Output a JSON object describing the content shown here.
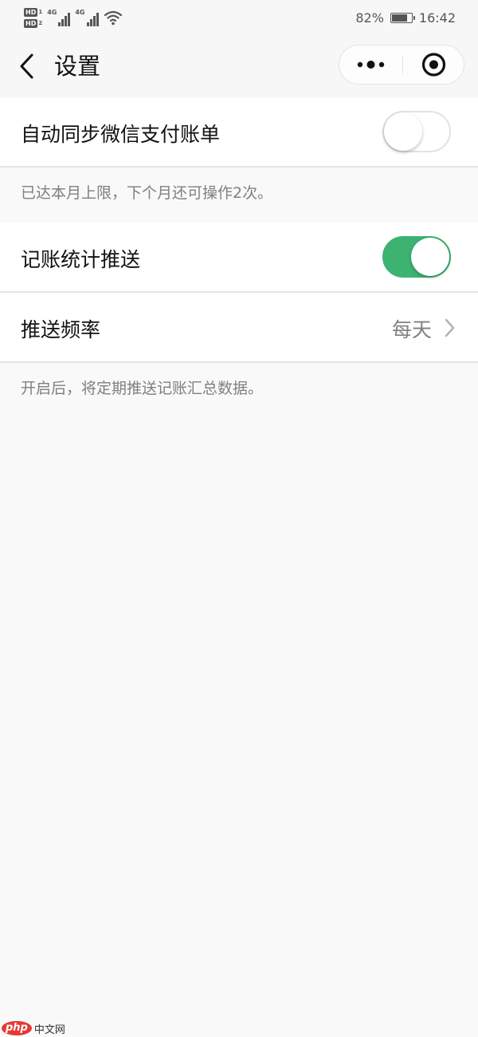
{
  "status_bar": {
    "hd1_label": "HD",
    "hd1_sub": "1",
    "hd2_label": "HD",
    "hd2_sub": "2",
    "network1": "4G",
    "network2": "4G",
    "battery_percent": "82%",
    "battery_level": 0.82,
    "time": "16:42"
  },
  "nav": {
    "title": "设置",
    "icons": {
      "back": "chevron-left-icon",
      "more": "more-dots-icon",
      "close": "target-icon"
    }
  },
  "settings": {
    "sync_bill": {
      "label": "自动同步微信支付账单",
      "enabled": false
    },
    "sync_bill_tip": "已达本月上限，下个月还可操作2次。",
    "stats_push": {
      "label": "记账统计推送",
      "enabled": true
    },
    "push_frequency": {
      "label": "推送频率",
      "value": "每天"
    },
    "push_tip": "开启后，将定期推送记账汇总数据。"
  },
  "colors": {
    "accent": "#3cb371",
    "page_background": "#f9f9f9",
    "secondary_text": "#7f7f7f"
  },
  "watermark": {
    "logo": "php",
    "text": "中文网"
  }
}
